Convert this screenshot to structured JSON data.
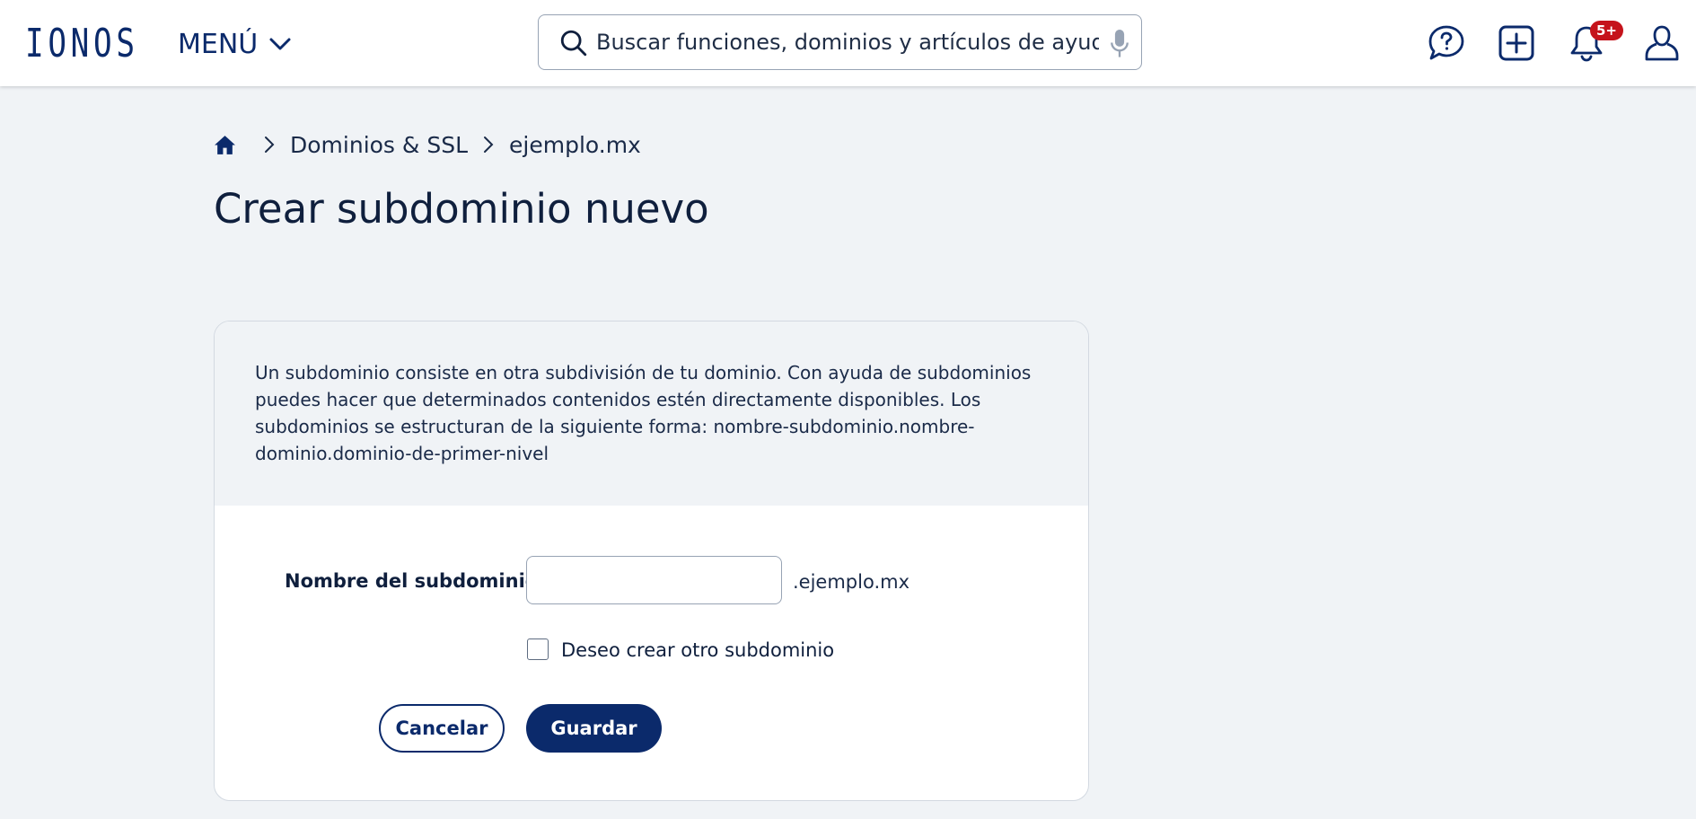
{
  "header": {
    "logo": "IONOS",
    "menu_label": "MENÚ",
    "search_placeholder": "Buscar funciones, dominios y artículos de ayuda",
    "notifications_badge": "5+"
  },
  "breadcrumb": {
    "items": [
      "Dominios & SSL",
      "ejemplo.mx"
    ]
  },
  "page": {
    "title": "Crear subdominio nuevo"
  },
  "form": {
    "intro": "Un subdominio consiste en otra subdivisión de tu dominio. Con ayuda de subdominios puedes hacer que determinados contenidos estén directamente disponibles. Los subdominios se estructuran de la siguiente forma: nombre-subdominio.nombre-dominio.dominio-de-primer-nivel",
    "subdomain_label": "Nombre del subdominio",
    "subdomain_value": "",
    "domain_suffix": ".ejemplo.mx",
    "checkbox_label": "Deseo crear otro subdominio",
    "checkbox_checked": false,
    "cancel_label": "Cancelar",
    "save_label": "Guardar"
  },
  "colors": {
    "brand": "#0b2a6b",
    "badge": "#c5131b",
    "background": "#f0f3f6"
  }
}
